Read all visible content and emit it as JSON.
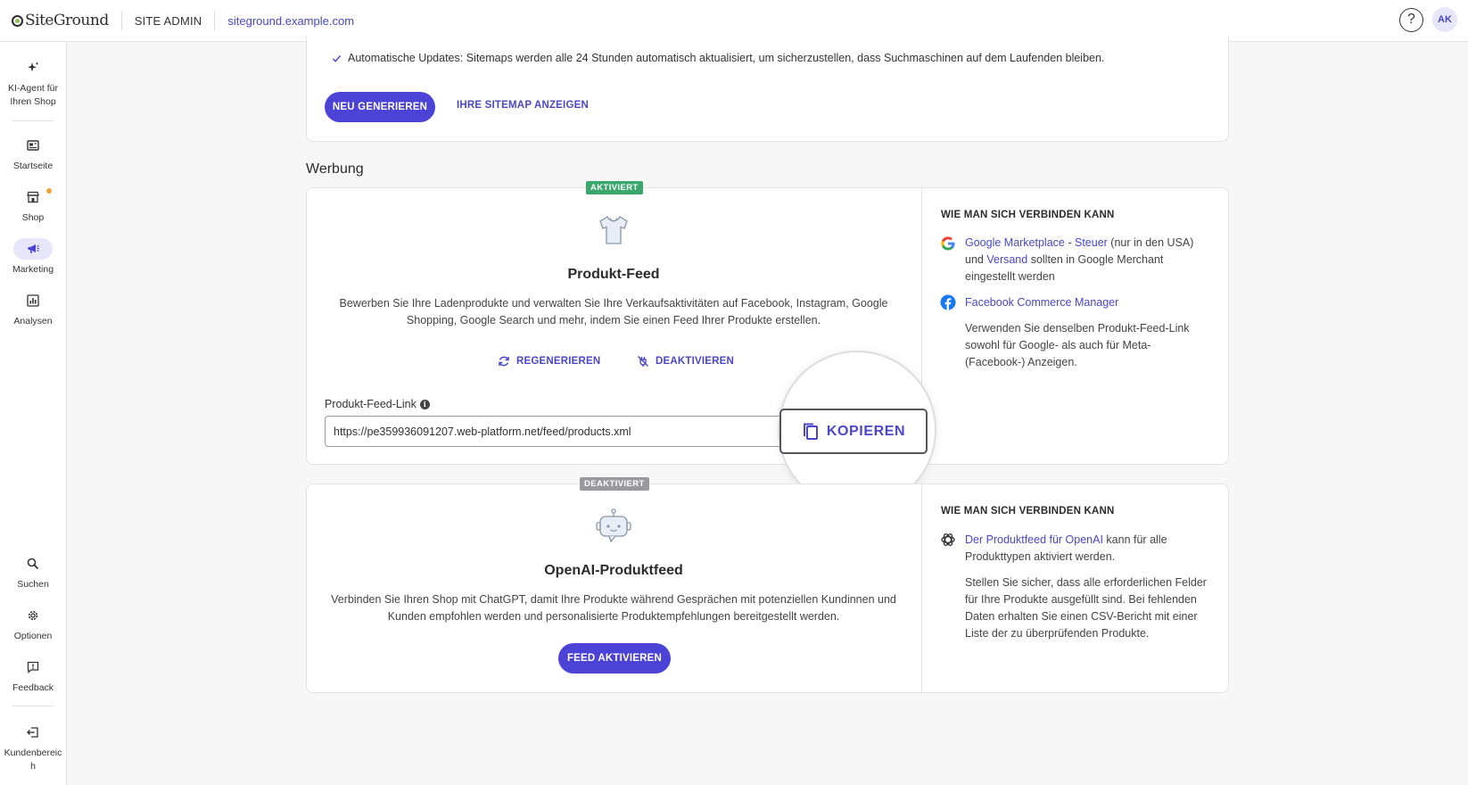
{
  "topbar": {
    "logo": "SiteGround",
    "site_admin": "SITE ADMIN",
    "domain": "siteground.example.com",
    "help": "?",
    "avatar": "AK"
  },
  "sidebar": {
    "items": [
      {
        "label": "KI-Agent für Ihren Shop",
        "icon": "sparkle-icon"
      },
      {
        "label": "Startseite",
        "icon": "dashboard-icon"
      },
      {
        "label": "Shop",
        "icon": "store-icon"
      },
      {
        "label": "Marketing",
        "icon": "megaphone-icon",
        "active": true
      },
      {
        "label": "Analysen",
        "icon": "chart-icon"
      },
      {
        "label": "Suchen",
        "icon": "search-icon"
      },
      {
        "label": "Optionen",
        "icon": "gear-icon"
      },
      {
        "label": "Feedback",
        "icon": "feedback-icon"
      },
      {
        "label": "Kundenbereich",
        "icon": "exit-icon"
      }
    ]
  },
  "sitemap": {
    "auto_update_text": "Automatische Updates: Sitemaps werden alle 24 Stunden automatisch aktualisiert, um sicherzustellen, dass Suchmaschinen auf dem Laufenden bleiben.",
    "regenerate_button": "NEU GENERIEREN",
    "view_sitemap_link": "IHRE SITEMAP ANZEIGEN"
  },
  "advertising": {
    "section_title": "Werbung",
    "product_feed": {
      "status_badge": "AKTIVIERT",
      "title": "Produkt-Feed",
      "description": "Bewerben Sie Ihre Ladenprodukte und verwalten Sie Ihre Verkaufsaktivitäten auf Facebook, Instagram, Google Shopping, Google Search und mehr, indem Sie einen Feed Ihrer Produkte erstellen.",
      "regenerate_action": "REGENERIEREN",
      "deactivate_action": "DEAKTIVIEREN",
      "link_label": "Produkt-Feed-Link",
      "link_value": "https://pe359936091207.web-platform.net/feed/products.xml",
      "copy_button": "KOPIEREN",
      "connect": {
        "heading": "WIE MAN SICH VERBINDEN KANN",
        "google_link_1": "Google Marketplace",
        "google_dash": " - ",
        "google_link_2": "Steuer",
        "google_text_1": " (nur in den USA) und ",
        "google_link_3": "Versand",
        "google_text_2": " sollten in Google Merchant eingestellt werden",
        "facebook_link": "Facebook Commerce Manager",
        "note": "Verwenden Sie denselben Produkt-Feed-Link sowohl für Google- als auch für Meta- (Facebook-) Anzeigen."
      }
    },
    "openai_feed": {
      "status_badge": "DEAKTIVIERT",
      "title": "OpenAI-Produktfeed",
      "description": "Verbinden Sie Ihren Shop mit ChatGPT, damit Ihre Produkte während Gesprächen mit potenziellen Kundinnen und Kunden empfohlen werden und personalisierte Produktempfehlungen bereitgestellt werden.",
      "activate_button": "FEED AKTIVIEREN",
      "connect": {
        "heading": "WIE MAN SICH VERBINDEN KANN",
        "openai_link": "Der Produktfeed für OpenAI",
        "openai_text": " kann für alle Produkttypen aktiviert werden.",
        "note": "Stellen Sie sicher, dass alle erforderlichen Felder für Ihre Produkte ausgefüllt sind. Bei fehlenden Daten erhalten Sie einen CSV-Bericht mit einer Liste der zu überprüfenden Produkte."
      }
    }
  },
  "colors": {
    "accent": "#4a43d6",
    "activated_badge": "#3aa76d",
    "deactivated_badge": "#9a9a9e"
  }
}
